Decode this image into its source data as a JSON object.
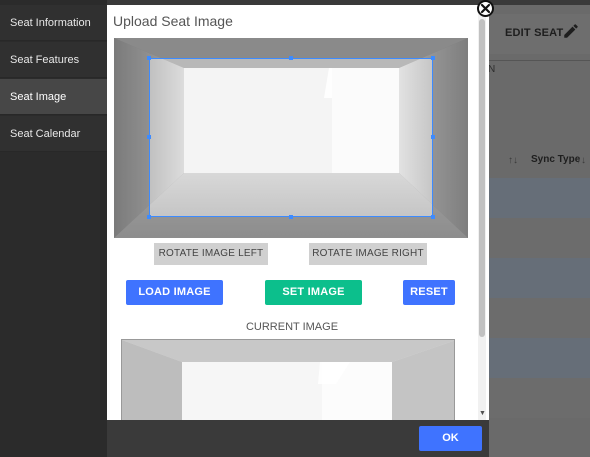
{
  "sidebar": {
    "items": [
      {
        "label": "Seat Information",
        "active": false
      },
      {
        "label": "Seat Features",
        "active": false
      },
      {
        "label": "Seat Image",
        "active": true
      },
      {
        "label": "Seat Calendar",
        "active": false
      }
    ]
  },
  "modal": {
    "title": "Upload Seat Image",
    "rotate_left_label": "ROTATE IMAGE LEFT",
    "rotate_right_label": "ROTATE IMAGE RIGHT",
    "load_image_label": "LOAD IMAGE",
    "set_image_label": "SET IMAGE",
    "reset_label": "RESET",
    "current_image_label": "CURRENT IMAGE",
    "ok_label": "OK"
  },
  "background": {
    "edit_seat_label": "EDIT SEAT",
    "column_header": "Sync Type",
    "partial_text": "N"
  },
  "icons": {
    "close": "close-icon",
    "pencil": "pencil-icon",
    "sort": "sort-icon"
  },
  "colors": {
    "accent_blue": "#3f73ff",
    "accent_green": "#0cbf8c",
    "crop_border": "#3d8bff",
    "sidebar_bg": "#2b2b2b",
    "sidebar_active": "#474747"
  }
}
